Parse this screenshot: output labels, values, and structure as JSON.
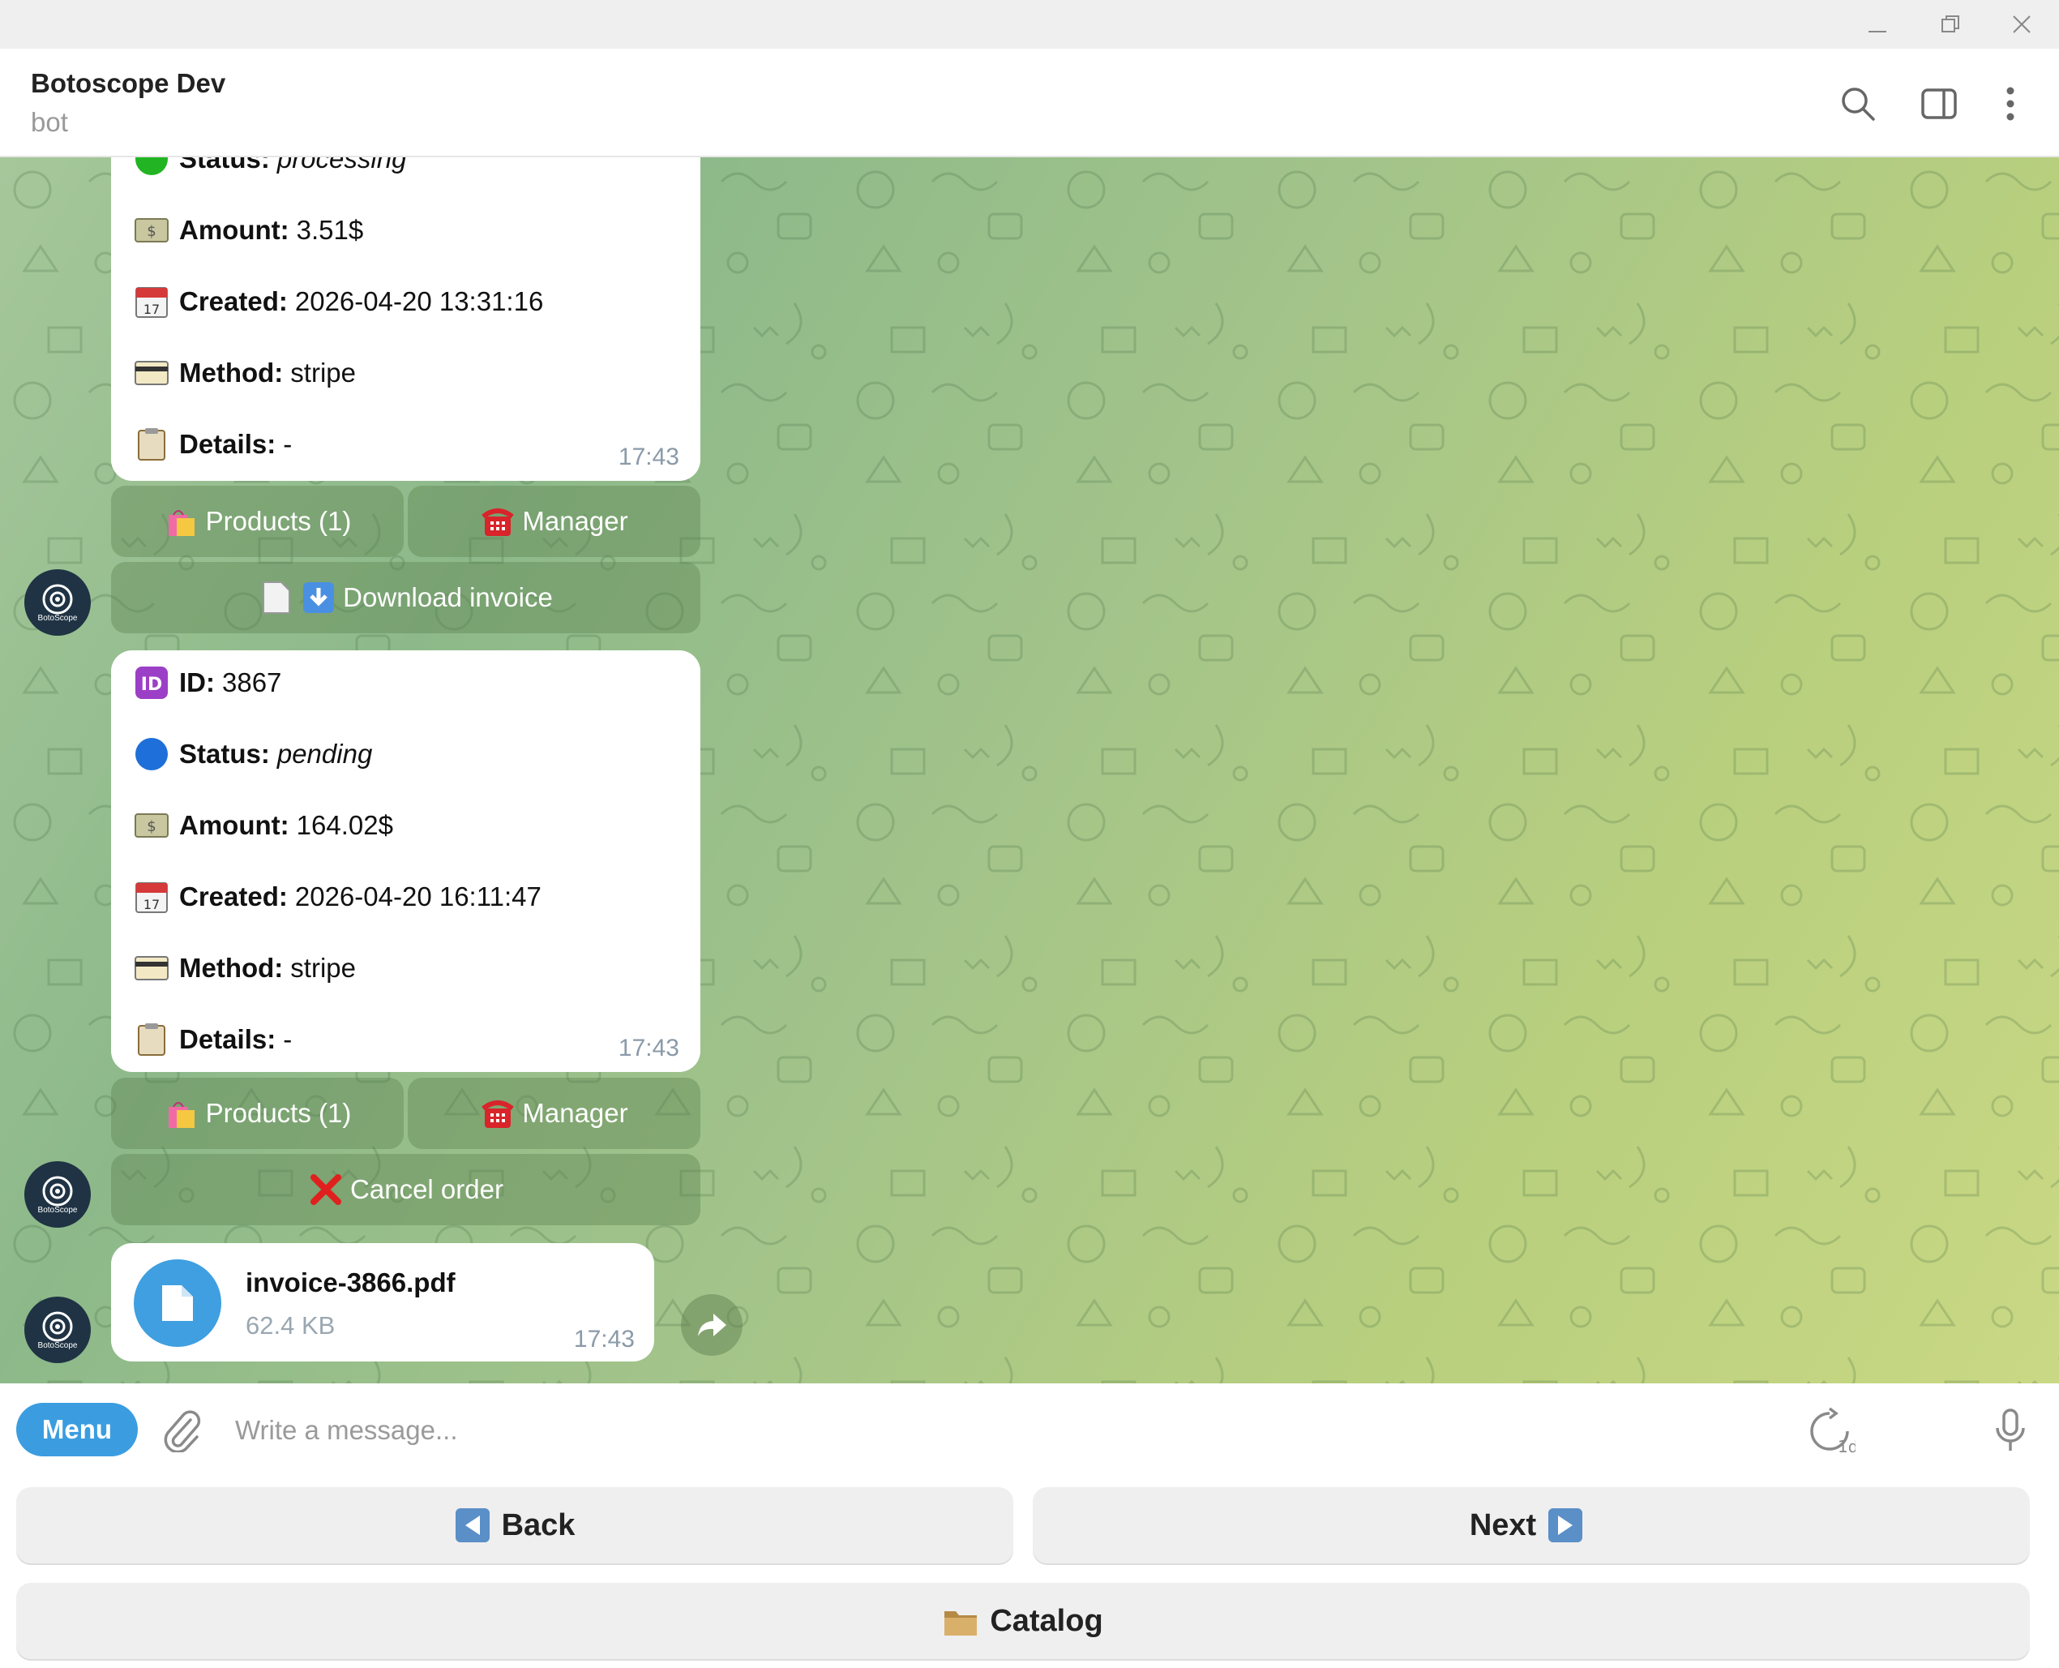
{
  "window": {
    "controls": [
      {
        "name": "minimize-icon"
      },
      {
        "name": "restore-icon"
      },
      {
        "name": "close-icon"
      }
    ]
  },
  "header": {
    "title": "Botoscope Dev",
    "subtitle": "bot",
    "icons": [
      "search-icon",
      "sidebar-toggle-icon",
      "more-vertical-icon"
    ]
  },
  "bot_avatar": {
    "text": "BotoScope"
  },
  "order1": {
    "status_label": "Status:",
    "status_value": "processing",
    "amount_label": "Amount:",
    "amount_value": "3.51$",
    "created_label": "Created:",
    "created_value": "2026-04-20 13:31:16",
    "method_label": "Method:",
    "method_value": "stripe",
    "details_label": "Details:",
    "details_value": "-",
    "time": "17:43",
    "buttons": {
      "products": "Products (1)",
      "manager": "Manager",
      "invoice": "Download invoice"
    }
  },
  "order2": {
    "id_label": "ID:",
    "id_value": "3867",
    "status_label": "Status:",
    "status_value": "pending",
    "amount_label": "Amount:",
    "amount_value": "164.02$",
    "created_label": "Created:",
    "created_value": "2026-04-20 16:11:47",
    "method_label": "Method:",
    "method_value": "stripe",
    "details_label": "Details:",
    "details_value": "-",
    "time": "17:43",
    "buttons": {
      "products": "Products (1)",
      "manager": "Manager",
      "cancel": "Cancel order"
    }
  },
  "file": {
    "name": "invoice-3866.pdf",
    "size": "62.4 KB",
    "time": "17:43"
  },
  "composer": {
    "menu_label": "Menu",
    "placeholder": "Write a message...",
    "timer_label": "1d"
  },
  "reply_keyboard": {
    "back": "Back",
    "next": "Next",
    "catalog": "Catalog"
  },
  "colors": {
    "accent": "#3b9de0",
    "status_processing": "#22b422",
    "status_pending": "#1e6fd9",
    "cancel_red": "#e0201e"
  }
}
